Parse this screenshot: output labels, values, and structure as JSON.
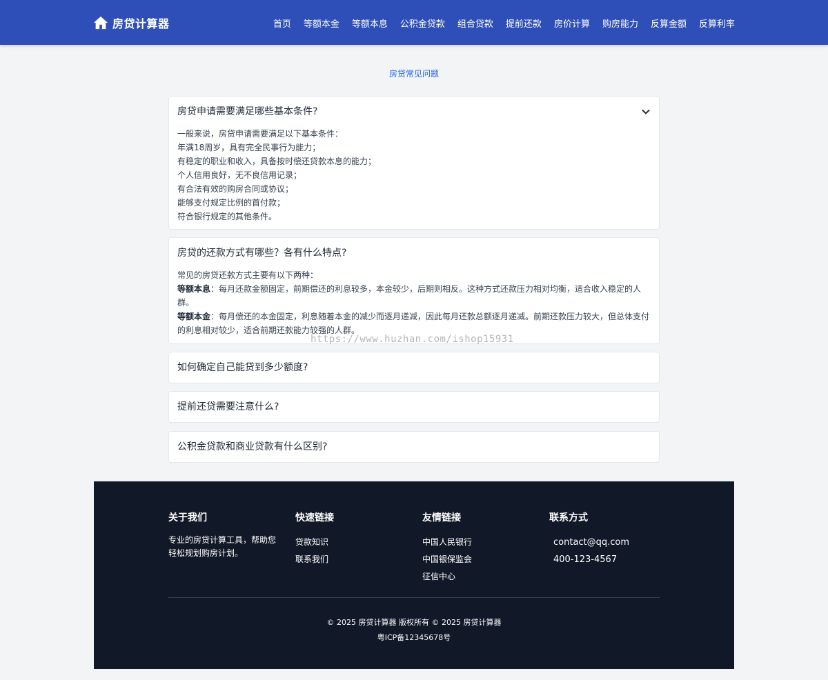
{
  "header": {
    "brand": "房贷计算器",
    "nav": [
      "首页",
      "等额本金",
      "等额本息",
      "公积金贷款",
      "组合贷款",
      "提前还款",
      "房价计算",
      "购房能力",
      "反算金额",
      "反算利率"
    ]
  },
  "faq_title": "房贷常见问题",
  "faqs": [
    {
      "question": "房贷申请需要满足哪些基本条件?",
      "answer_lines": [
        "一般来说，房贷申请需要满足以下基本条件：",
        "年满18周岁，具有完全民事行为能力；",
        "有稳定的职业和收入，具备按时偿还贷款本息的能力；",
        "个人信用良好，无不良信用记录；",
        "有合法有效的购房合同或协议；",
        "能够支付规定比例的首付款；",
        "符合银行规定的其他条件。"
      ]
    },
    {
      "question": "房贷的还款方式有哪些？各有什么特点?",
      "intro": "常见的房贷还款方式主要有以下两种：",
      "items": [
        {
          "term": "等额本息",
          "desc": "：每月还款金额固定，前期偿还的利息较多，本金较少，后期则相反。这种方式还款压力相对均衡，适合收入稳定的人群。"
        },
        {
          "term": "等额本金",
          "desc": "：每月偿还的本金固定，利息随着本金的减少而逐月递减，因此每月还款总额逐月递减。前期还款压力较大，但总体支付的利息相对较少，适合前期还款能力较强的人群。"
        }
      ]
    },
    {
      "question": "如何确定自己能贷到多少额度?"
    },
    {
      "question": "提前还贷需要注意什么?"
    },
    {
      "question": "公积金贷款和商业贷款有什么区别?"
    }
  ],
  "watermark": "https://www.huzhan.com/ishop15931",
  "footer": {
    "about_title": "关于我们",
    "about_text": "专业的房贷计算工具，帮助您轻松规划购房计划。",
    "quick_title": "快速链接",
    "quick_links": [
      "贷款知识",
      "联系我们"
    ],
    "friend_title": "友情链接",
    "friend_links": [
      "中国人民银行",
      "中国银保监会",
      "征信中心"
    ],
    "contact_title": "联系方式",
    "contact_email": "contact@qq.com",
    "contact_phone": "400-123-4567",
    "copyright": "© 2025 房贷计算器 版权所有 © 2025 房贷计算器",
    "icp": "粤ICP备12345678号"
  },
  "colors": {
    "header_bg": "#2f4fb8",
    "footer_bg": "#111827",
    "accent": "#2563eb"
  },
  "icons": {
    "brand": "home-icon",
    "faq_toggle": "chevron-down-icon"
  }
}
